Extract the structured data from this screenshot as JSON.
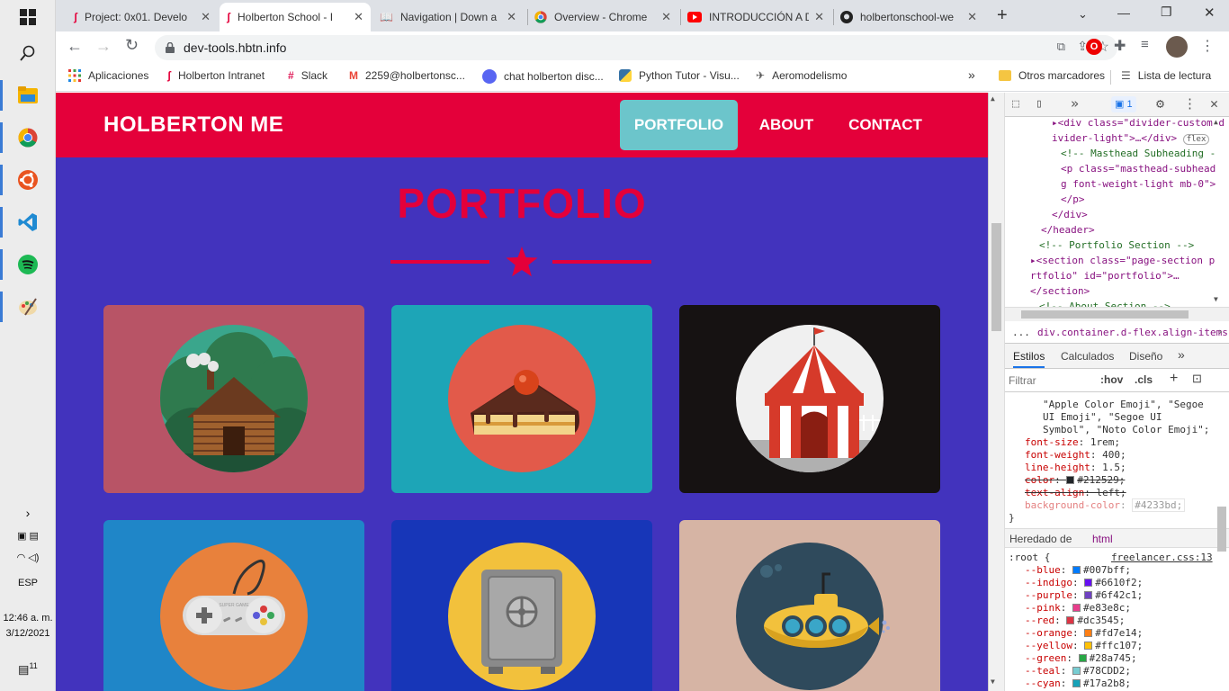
{
  "taskbar": {
    "icons": [
      "windows-icon",
      "search-icon",
      "file-explorer-icon",
      "chrome-icon",
      "ubuntu-icon",
      "vscode-icon",
      "spotify-icon",
      "paint-icon"
    ],
    "tray_lang": "ESP",
    "time": "12:46 a. m.",
    "date": "3/12/2021",
    "notification_count": "11"
  },
  "browser": {
    "tabs": [
      {
        "label": "Project: 0x01. Develo",
        "icon": "holberton-icon"
      },
      {
        "label": "Holberton School - I",
        "icon": "holberton-icon",
        "active": true
      },
      {
        "label": "Navigation | Down a",
        "icon": "book-icon"
      },
      {
        "label": "Overview - Chrome",
        "icon": "chrome-icon"
      },
      {
        "label": "INTRODUCCIÓN A D",
        "icon": "youtube-icon"
      },
      {
        "label": "holbertonschool-we",
        "icon": "github-icon"
      }
    ],
    "url": "dev-tools.hbtn.info",
    "bookmarks": [
      {
        "label": "Aplicaciones",
        "icon": "apps-grid-icon"
      },
      {
        "label": "Holberton Intranet",
        "icon": "holberton-icon"
      },
      {
        "label": "Slack",
        "icon": "slack-icon"
      },
      {
        "label": "2259@holbertonsc...",
        "icon": "gmail-icon"
      },
      {
        "label": "chat holberton disc...",
        "icon": "discord-icon"
      },
      {
        "label": "Python Tutor - Visu...",
        "icon": "python-icon"
      },
      {
        "label": "Aeromodelismo",
        "icon": "plane-icon"
      }
    ],
    "bookmarks_more": "»",
    "other_bookmarks": "Otros marcadores",
    "reading_list": "Lista de lectura"
  },
  "page": {
    "brand": "HOLBERTON ME",
    "nav": [
      {
        "label": "PORTFOLIO",
        "active": true
      },
      {
        "label": "ABOUT"
      },
      {
        "label": "CONTACT"
      }
    ],
    "section_title": "PORTFOLIO",
    "portfolio_items": [
      {
        "name": "cabin",
        "bg": "#b85466",
        "circle": "#3aa68c"
      },
      {
        "name": "cake",
        "bg": "#1da5b7",
        "circle": "#e25a4a"
      },
      {
        "name": "circus",
        "bg": "#161212",
        "circle": "#f0f0f0"
      },
      {
        "name": "game",
        "bg": "#1f86c8",
        "circle": "#e8813c"
      },
      {
        "name": "safe",
        "bg": "#1736b8",
        "circle": "#f2c13c"
      },
      {
        "name": "submarine",
        "bg": "#d6b4a4",
        "circle": "#2f4a5c"
      }
    ],
    "colors": {
      "nav_bg": "#e4003a",
      "page_bg": "#4233bd",
      "active_link_bg": "#6cc5cb"
    }
  },
  "devtools": {
    "issues_count": "1",
    "elements": [
      {
        "indent": 3,
        "text": "▸<div class=\"divider-custom d"
      },
      {
        "indent": 3,
        "text": "ivider-light\">…</div>",
        "badge": "flex"
      },
      {
        "indent": 4,
        "text": "<!-- Masthead Subheading -"
      },
      {
        "indent": 4,
        "text": "<p class=\"masthead-subhead"
      },
      {
        "indent": 4,
        "text": "g font-weight-light mb-0\">"
      },
      {
        "indent": 4,
        "text": "</p>"
      },
      {
        "indent": 3,
        "text": "</div>"
      },
      {
        "indent": 2,
        "text": "</header>"
      },
      {
        "indent": 2,
        "text": "<!-- Portfolio Section -->"
      },
      {
        "indent": 1,
        "text": "▸<section class=\"page-section p"
      },
      {
        "indent": 1,
        "text": "rtfolio\" id=\"portfolio\">…"
      },
      {
        "indent": 1,
        "text": "</section>"
      },
      {
        "indent": 1,
        "text": "<!-- About Section -->"
      }
    ],
    "breadcrumb": "div.container.d-flex.align-items-cer",
    "breadcrumb_more": "...",
    "tabs": [
      "Estilos",
      "Calculados",
      "Diseño"
    ],
    "tabs_more": "»",
    "filter_placeholder": "Filtrar",
    "hov": ":hov",
    "cls": ".cls",
    "style_lines": [
      "\"Apple Color Emoji\", \"Segoe",
      "UI Emoji\", \"Segoe UI",
      "Symbol\", \"Noto Color Emoji\";"
    ],
    "props": [
      {
        "name": "font-size",
        "value": "1rem;"
      },
      {
        "name": "font-weight",
        "value": "400;"
      },
      {
        "name": "line-height",
        "value": "1.5;"
      },
      {
        "name": "color",
        "value": "#212529;",
        "swatch": "#212529",
        "strike": true
      },
      {
        "name": "text-align",
        "value": "left;",
        "strike": true
      },
      {
        "name": "background-color",
        "value": "#4233bd;",
        "faded": true
      }
    ],
    "inherited_label": "Heredado de",
    "inherited_tag": "html",
    "root_selector": ":root {",
    "root_source": "freelancer.css:13",
    "vars": [
      {
        "name": "--blue",
        "value": "#007bff;"
      },
      {
        "name": "--indigo",
        "value": "#6610f2;"
      },
      {
        "name": "--purple",
        "value": "#6f42c1;"
      },
      {
        "name": "--pink",
        "value": "#e83e8c;"
      },
      {
        "name": "--red",
        "value": "#dc3545;"
      },
      {
        "name": "--orange",
        "value": "#fd7e14;"
      },
      {
        "name": "--yellow",
        "value": "#ffc107;"
      },
      {
        "name": "--green",
        "value": "#28a745;"
      },
      {
        "name": "--teal",
        "value": "#78CDD2;"
      },
      {
        "name": "--cyan",
        "value": "#17a2b8;"
      }
    ]
  }
}
